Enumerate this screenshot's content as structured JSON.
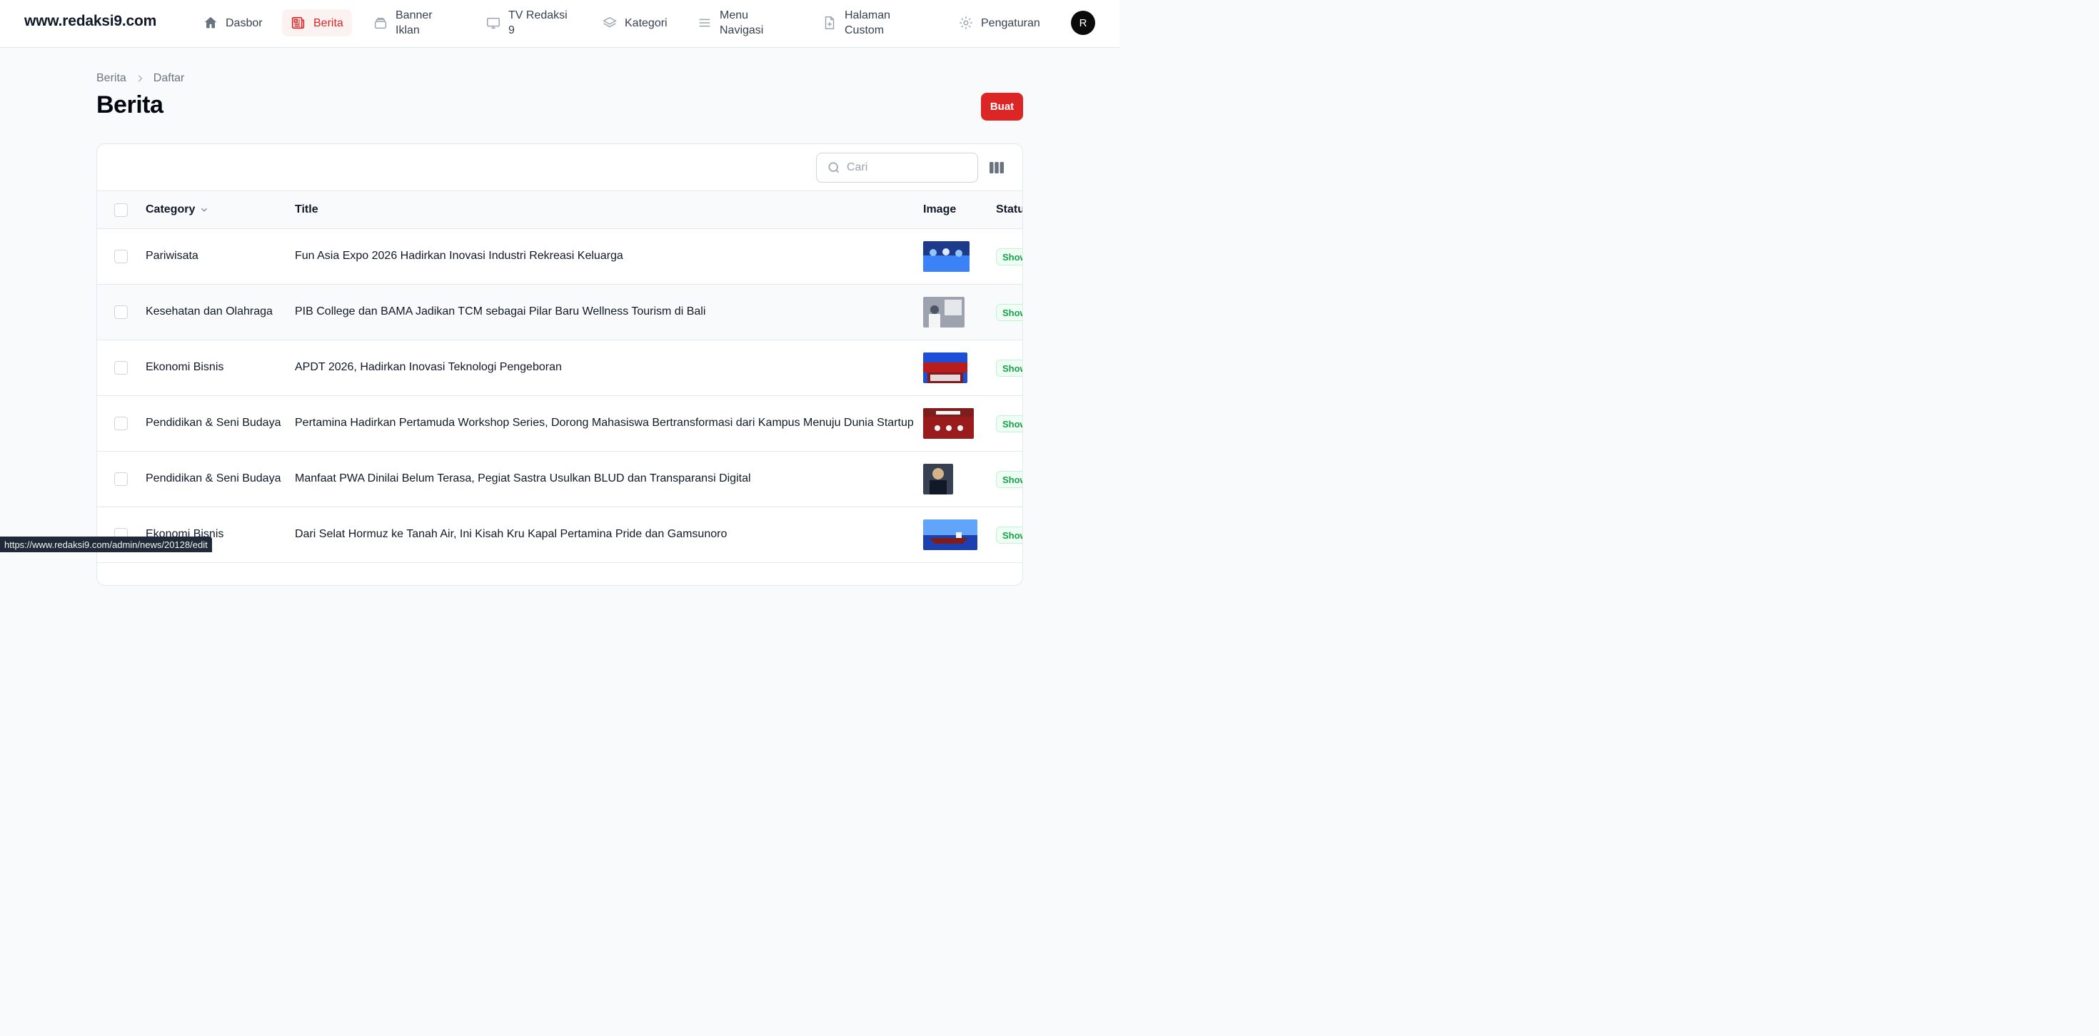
{
  "brand": "www.redaksi9.com",
  "nav": {
    "items": [
      {
        "label": "Dasbor",
        "icon": "home-icon"
      },
      {
        "label": "Berita",
        "icon": "newspaper-icon",
        "active": true
      },
      {
        "label": "Banner Iklan",
        "icon": "banner-stack-icon"
      },
      {
        "label": "TV Redaksi 9",
        "icon": "monitor-icon"
      },
      {
        "label": "Kategori",
        "icon": "layers-icon"
      },
      {
        "label": "Menu Navigasi",
        "icon": "menu-lines-icon"
      },
      {
        "label": "Halaman Custom",
        "icon": "document-plus-icon"
      },
      {
        "label": "Pengaturan",
        "icon": "gear-icon"
      }
    ],
    "avatar_initial": "R"
  },
  "breadcrumb": [
    "Berita",
    "Daftar"
  ],
  "page": {
    "title": "Berita",
    "create_label": "Buat"
  },
  "search": {
    "placeholder": "Cari",
    "value": ""
  },
  "table": {
    "columns": {
      "category": "Category",
      "title": "Title",
      "image": "Image",
      "status": "Status"
    },
    "rows": [
      {
        "category": "Pariwisata",
        "title": "Fun Asia Expo 2026 Hadirkan Inovasi Industri Rekreasi Keluarga",
        "status": "Show",
        "thumb": {
          "bg": "#1e3a8a",
          "accent": "#3b82f6"
        }
      },
      {
        "category": "Kesehatan dan Olahraga",
        "title": "PIB College dan BAMA Jadikan TCM sebagai Pilar Baru Wellness Tourism di Bali",
        "status": "Show",
        "thumb": {
          "bg": "#9ca3af",
          "accent": "#e5e7eb"
        }
      },
      {
        "category": "Ekonomi Bisnis",
        "title": "APDT 2026, Hadirkan Inovasi Teknologi Pengeboran",
        "status": "Show",
        "thumb": {
          "bg": "#1d4ed8",
          "accent": "#b91c1c"
        }
      },
      {
        "category": "Pendidikan & Seni Budaya",
        "title": "Pertamina Hadirkan Pertamuda Workshop Series, Dorong Mahasiswa Bertransformasi dari Kampus Menuju Dunia Startup",
        "status": "Show",
        "thumb": {
          "bg": "#991b1b",
          "accent": "#f3f4f6"
        }
      },
      {
        "category": "Pendidikan & Seni Budaya",
        "title": "Manfaat PWA Dinilai Belum Terasa, Pegiat Sastra Usulkan BLUD dan Transparansi Digital",
        "status": "Show",
        "thumb": {
          "bg": "#374151",
          "accent": "#d6b48a"
        }
      },
      {
        "category": "Ekonomi Bisnis",
        "title": "Dari Selat Hormuz ke Tanah Air, Ini Kisah Kru Kapal Pertamina Pride dan Gamsunoro",
        "status": "Show",
        "thumb": {
          "bg": "#1e40af",
          "accent": "#7f1d1d"
        }
      }
    ]
  },
  "status_url": "https://www.redaksi9.com/admin/news/20128/edit"
}
